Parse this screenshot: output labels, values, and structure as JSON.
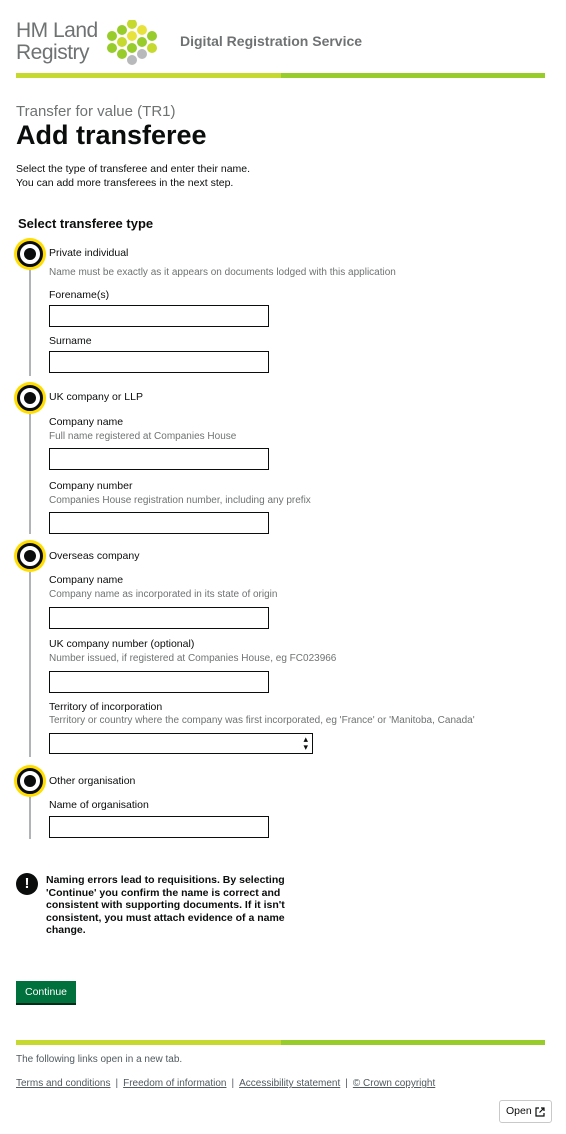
{
  "header": {
    "logo_line1": "HM Land",
    "logo_line2": "Registry",
    "service_name": "Digital Registration Service",
    "brand_colors": [
      "#c5d92e",
      "#98cc2a",
      "#6f7273"
    ]
  },
  "page": {
    "caption": "Transfer for value (TR1)",
    "title": "Add transferee",
    "intro_line1": "Select the type of transferee and enter their name.",
    "intro_line2": "You can add more transferees in the next step."
  },
  "form": {
    "legend": "Select transferee type",
    "private_individual": {
      "label": "Private individual",
      "hint": "Name must be exactly as it appears on documents lodged with this application",
      "forename_label": "Forename(s)",
      "surname_label": "Surname",
      "forename_value": "",
      "surname_value": ""
    },
    "uk_company": {
      "label": "UK company or LLP",
      "name_label": "Company name",
      "name_hint": "Full name registered at Companies House",
      "number_label": "Company number",
      "number_hint": "Companies House registration number, including any prefix",
      "name_value": "",
      "number_value": ""
    },
    "overseas_company": {
      "label": "Overseas company",
      "name_label": "Company name",
      "name_hint": "Company name as incorporated in its state of origin",
      "number_label": "UK company number (optional)",
      "number_hint": "Number issued, if registered at Companies House, eg FC023966",
      "territory_label": "Territory of incorporation",
      "territory_hint": "Territory or country where the company was first incorporated, eg 'France' or 'Manitoba, Canada'",
      "territory_selected": ""
    },
    "other_organisation": {
      "label": "Other organisation",
      "name_label": "Name of organisation",
      "name_value": ""
    }
  },
  "warning": {
    "icon": "!",
    "text": "Naming errors lead to requisitions. By selecting 'Continue' you confirm the name is correct and consistent with supporting documents. If it isn't consistent, you must attach evidence of a name change."
  },
  "actions": {
    "continue_label": "Continue",
    "continue_color": "#00703c"
  },
  "footer": {
    "note": "The following links open in a new tab.",
    "links": [
      "Terms and conditions",
      "Freedom of information",
      "Accessibility statement",
      "© Crown copyright"
    ],
    "open_label": "Open"
  }
}
